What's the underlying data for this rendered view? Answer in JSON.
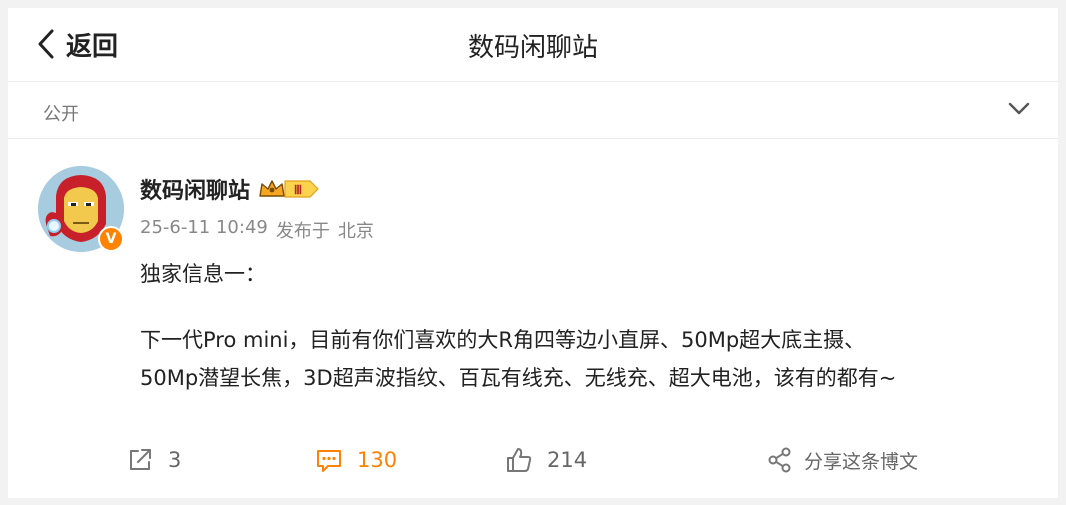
{
  "header": {
    "back_label": "返回",
    "title": "数码闲聊站"
  },
  "visibility": {
    "label": "公开"
  },
  "post": {
    "username": "数码闲聊站",
    "vip_level": "Ⅲ",
    "verified_mark": "V",
    "timestamp": "25-6-11 10:49",
    "posted_from": "发布于",
    "location": "北京",
    "line_title": "独家信息一：",
    "line_body_1": "下一代Pro mini，目前有你们喜欢的大R角四等边小直屏、50Mp超大底主摄、",
    "line_body_2": "50Mp潜望长焦，3D超声波指纹、百瓦有线充、无线充、超大电池，该有的都有~"
  },
  "actions": {
    "repost_count": "3",
    "comment_count": "130",
    "like_count": "214",
    "share_label": "分享这条博文"
  },
  "colors": {
    "accent": "#ff8200",
    "text": "#222222",
    "muted": "#888888"
  }
}
